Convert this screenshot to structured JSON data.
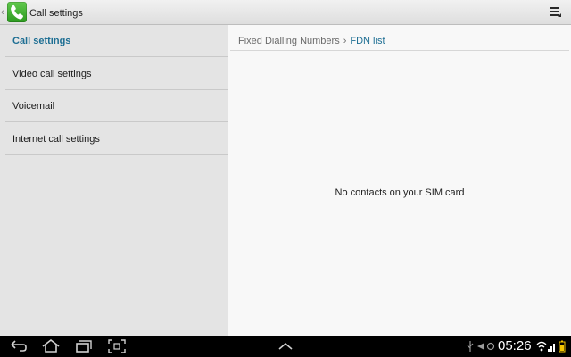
{
  "app": {
    "title": "Call settings",
    "icon": "phone-icon"
  },
  "sidebar": {
    "items": [
      {
        "label": "Call settings",
        "active": true
      },
      {
        "label": "Video call settings",
        "active": false
      },
      {
        "label": "Voicemail",
        "active": false
      },
      {
        "label": "Internet call settings",
        "active": false
      }
    ]
  },
  "breadcrumb": {
    "parent": "Fixed Dialling Numbers",
    "current": "FDN list"
  },
  "main": {
    "empty_message": "No contacts on your SIM card"
  },
  "status_bar": {
    "time": "05:26"
  },
  "colors": {
    "accent": "#1d6e93",
    "sidebar_bg": "#e4e4e4",
    "content_bg": "#f8f8f8",
    "system_bar": "#000000"
  }
}
